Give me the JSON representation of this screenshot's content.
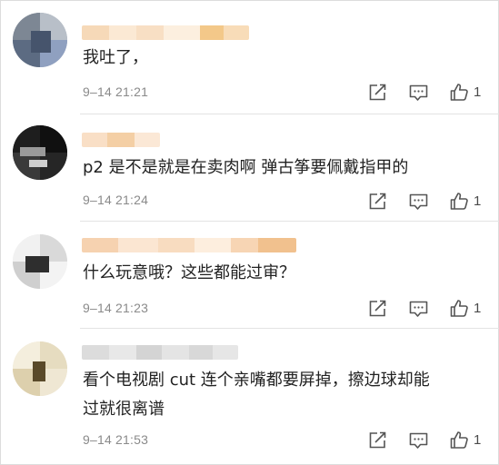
{
  "comments": [
    {
      "text": "我吐了，",
      "time": "9–14  21:21",
      "likes": "1",
      "edit_icon": "share-edit-icon",
      "reply_icon": "comment-bubble-icon",
      "like_icon": "thumbs-up-icon"
    },
    {
      "text": "p2 是不是就是在卖肉啊 弹古筝要佩戴指甲的",
      "time": "9–14  21:24",
      "likes": "1",
      "edit_icon": "share-edit-icon",
      "reply_icon": "comment-bubble-icon",
      "like_icon": "thumbs-up-icon"
    },
    {
      "text": "什么玩意哦？这些都能过审？",
      "time": "9–14  21:23",
      "likes": "1",
      "edit_icon": "share-edit-icon",
      "reply_icon": "comment-bubble-icon",
      "like_icon": "thumbs-up-icon"
    },
    {
      "text_line1": "看个电视剧 cut 连个亲嘴都要屏掉，擦边球却能",
      "text_line2": "过就很离谱",
      "time": "9–14  21:53",
      "likes": "1",
      "edit_icon": "share-edit-icon",
      "reply_icon": "comment-bubble-icon",
      "like_icon": "thumbs-up-icon"
    }
  ],
  "colors": {
    "text": "#222222",
    "meta": "#8a8a8a",
    "divider": "#e3e3e3",
    "icon": "#555555"
  }
}
